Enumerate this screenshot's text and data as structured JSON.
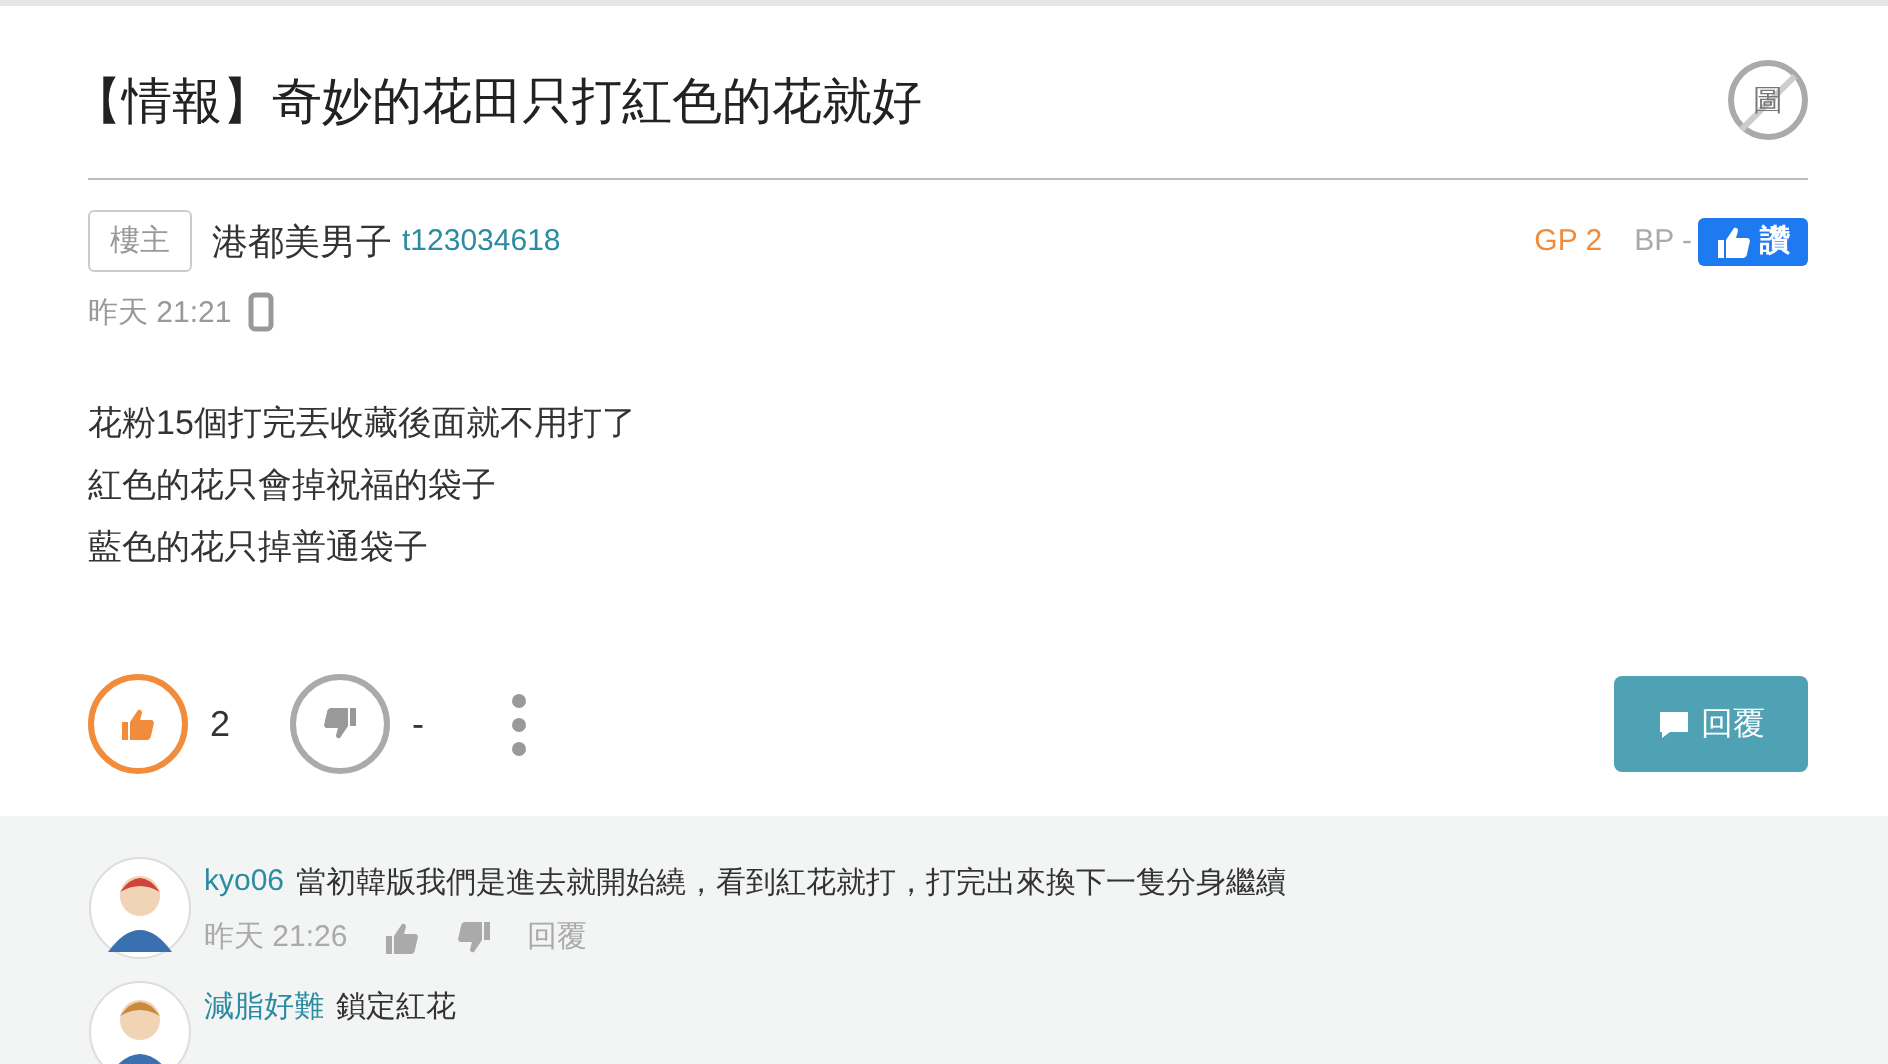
{
  "title": "【情報】奇妙的花田只打紅色的花就好",
  "no_image_icon": "圖",
  "author": {
    "badge": "樓主",
    "name": "港都美男子",
    "account": "t123034618"
  },
  "gp": "GP 2",
  "bp": "BP -",
  "bp_button": "讚",
  "time": "昨天 21:21",
  "from_mobile": true,
  "body": [
    "花粉15個打完丟收藏後面就不用打了",
    "紅色的花只會掉祝福的袋子",
    "藍色的花只掉普通袋子"
  ],
  "votes": [
    {
      "kind": "up",
      "count": "2",
      "selected": true
    },
    {
      "kind": "down",
      "count": "-",
      "selected": false
    }
  ],
  "reply_button": "回覆",
  "comments": [
    {
      "user": "kyo06",
      "text": "當初韓版我們是進去就開始繞，看到紅花就打，打完出來換下一隻分身繼續",
      "time": "昨天 21:26",
      "reply": "回覆"
    },
    {
      "user": "減脂好難",
      "text": "鎖定紅花"
    }
  ]
}
